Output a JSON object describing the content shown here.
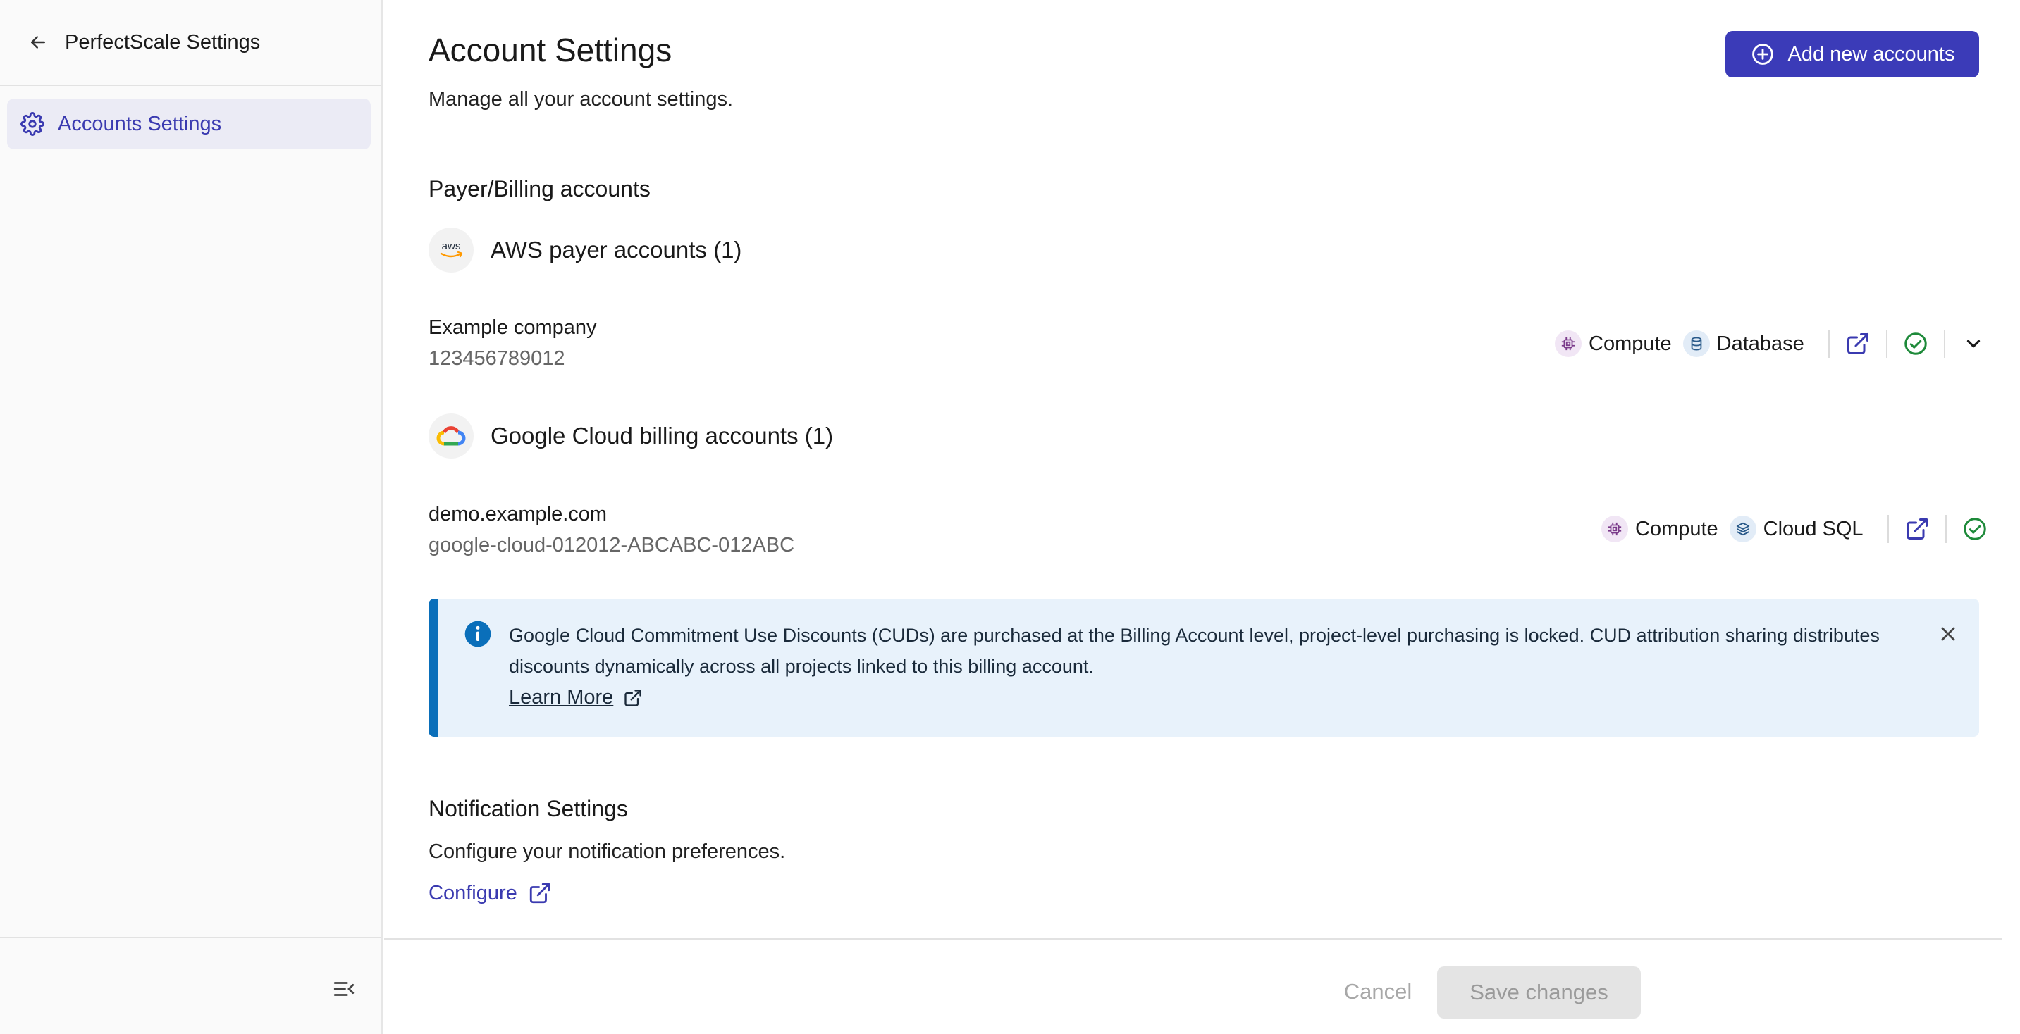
{
  "sidebar": {
    "title": "PerfectScale Settings",
    "items": [
      {
        "label": "Accounts Settings",
        "active": true
      }
    ]
  },
  "main": {
    "title": "Account Settings",
    "description": "Manage all your account settings.",
    "add_button_label": "Add new accounts",
    "billing_section_title": "Payer/Billing accounts",
    "aws": {
      "group_title": "AWS payer accounts (1)",
      "logo_text": "aws",
      "account": {
        "name": "Example company",
        "id": "123456789012",
        "services": [
          "Compute",
          "Database"
        ]
      }
    },
    "gcp": {
      "group_title": "Google Cloud billing accounts (1)",
      "account": {
        "name": "demo.example.com",
        "id": "google-cloud-012012-ABCABC-012ABC",
        "services": [
          "Compute",
          "Cloud SQL"
        ]
      }
    },
    "banner": {
      "message": "Google Cloud Commitment Use Discounts (CUDs) are purchased at the Billing Account level, project-level purchasing is locked. CUD attribution sharing distributes discounts dynamically across all projects linked to this billing account.",
      "link_label": "Learn More"
    },
    "notifications": {
      "title": "Notification Settings",
      "description": "Configure your notification preferences.",
      "link_label": "Configure"
    }
  },
  "footer": {
    "cancel_label": "Cancel",
    "save_label": "Save changes"
  },
  "colors": {
    "accent": "#3b3bb8",
    "success": "#1e8a3a",
    "info": "#0a6fba",
    "banner_bg": "#e8f2fb"
  }
}
